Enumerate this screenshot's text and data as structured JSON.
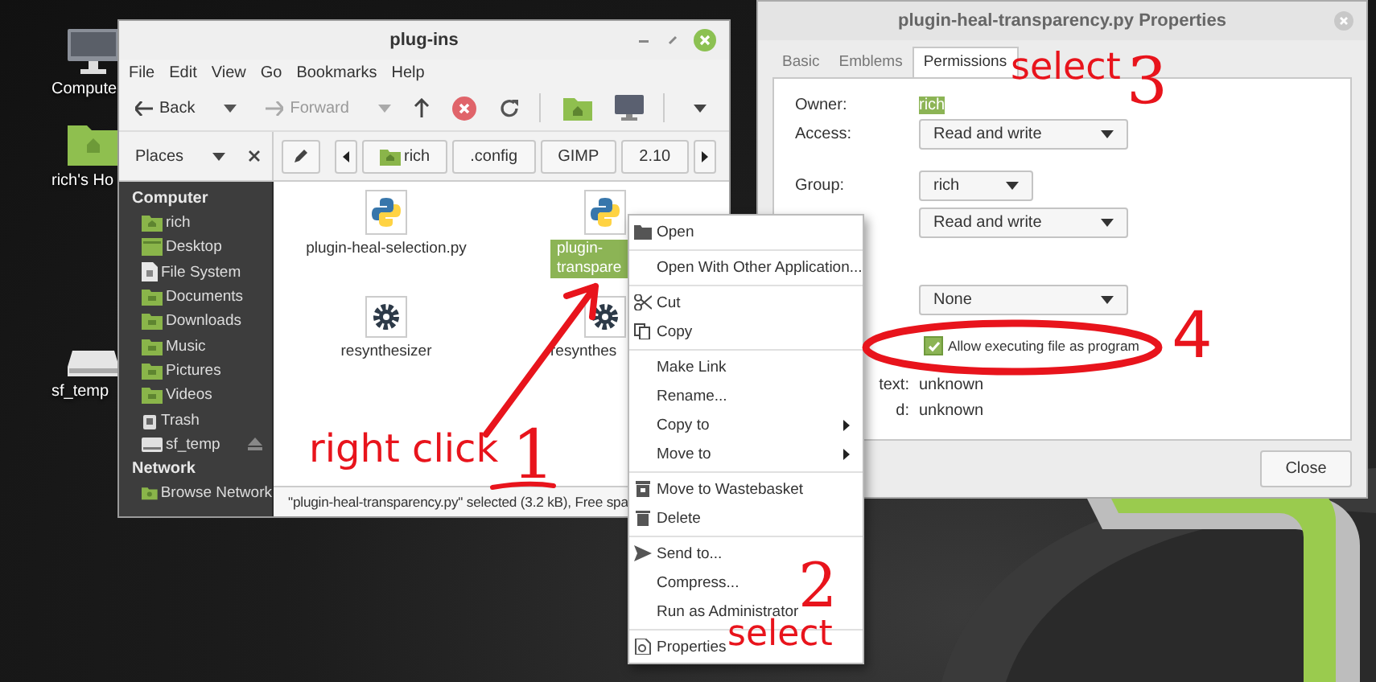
{
  "desktop": {
    "icons": [
      {
        "label": "Compute",
        "kind": "computer"
      },
      {
        "label": "rich's Ho",
        "kind": "home"
      },
      {
        "label": "sf_temp",
        "kind": "drive"
      }
    ]
  },
  "file_manager": {
    "title": "plug-ins",
    "menu": [
      "File",
      "Edit",
      "View",
      "Go",
      "Bookmarks",
      "Help"
    ],
    "toolbar": {
      "back": "Back",
      "forward": "Forward"
    },
    "places": "Places",
    "path": [
      {
        "label": "rich",
        "kind": "home"
      },
      {
        "label": ".config",
        "kind": "plain"
      },
      {
        "label": "GIMP",
        "kind": "plain"
      },
      {
        "label": "2.10",
        "kind": "plain"
      }
    ],
    "sidebar": [
      {
        "heading": "Computer",
        "items": [
          {
            "label": "rich",
            "kind": "home",
            "ejectable": false
          },
          {
            "label": "Desktop",
            "kind": "desktop",
            "ejectable": false
          },
          {
            "label": "File System",
            "kind": "filesystem",
            "ejectable": false
          },
          {
            "label": "Documents",
            "kind": "folder",
            "ejectable": false
          },
          {
            "label": "Downloads",
            "kind": "folder",
            "ejectable": false
          },
          {
            "label": "Music",
            "kind": "folder",
            "ejectable": false
          },
          {
            "label": "Pictures",
            "kind": "folder",
            "ejectable": false
          },
          {
            "label": "Videos",
            "kind": "folder",
            "ejectable": false
          },
          {
            "label": "Trash",
            "kind": "trash",
            "ejectable": false
          },
          {
            "label": "sf_temp",
            "kind": "drive",
            "ejectable": true
          }
        ]
      },
      {
        "heading": "Network",
        "items": [
          {
            "label": "Browse Network",
            "kind": "network",
            "ejectable": false
          }
        ]
      }
    ],
    "files": [
      {
        "lines": [
          "plugin-heal-selection.py"
        ],
        "kind": "python",
        "selected": false
      },
      {
        "lines": [
          "plugin-",
          "transpare"
        ],
        "kind": "python",
        "selected": true
      },
      {
        "lines": [
          "resynthesizer"
        ],
        "kind": "executable",
        "selected": false
      },
      {
        "lines": [
          "resynthes"
        ],
        "kind": "executable",
        "selected": false
      }
    ],
    "status": "\"plugin-heal-transparency.py\" selected (3.2 kB), Free spa"
  },
  "properties": {
    "title": "plugin-heal-transparency.py Properties",
    "tabs": [
      {
        "label": "Basic",
        "selected": false
      },
      {
        "label": "Emblems",
        "selected": false
      },
      {
        "label": "Permissions",
        "selected": true
      }
    ],
    "sections": [
      [
        {
          "kind": "text",
          "label": "Owner:",
          "value": "rich",
          "selected": true
        },
        {
          "kind": "dropdown",
          "label": "Access:",
          "value": "Read and write"
        }
      ],
      [
        {
          "kind": "short-dropdown",
          "label": "Group:",
          "value": "rich"
        },
        {
          "kind": "dropdown",
          "value": "Read and write"
        }
      ],
      [
        {
          "kind": "dropdown",
          "value": "None"
        },
        {
          "kind": "checkbox",
          "label": "Allow executing file as program",
          "checked": true
        },
        {
          "kind": "info",
          "label": "text:",
          "value": "unknown"
        },
        {
          "kind": "info",
          "label": "d:",
          "value": "unknown"
        }
      ]
    ],
    "close": "Close"
  },
  "context_menu": [
    {
      "kind": "folder",
      "label": "Open",
      "submenu": false
    },
    {
      "kind": "separator"
    },
    {
      "kind": "plain",
      "label": "Open With Other Application...",
      "submenu": false
    },
    {
      "kind": "separator"
    },
    {
      "kind": "cut",
      "label": "Cut",
      "submenu": false
    },
    {
      "kind": "copy",
      "label": "Copy",
      "submenu": false
    },
    {
      "kind": "separator"
    },
    {
      "kind": "plain",
      "label": "Make Link",
      "submenu": false
    },
    {
      "kind": "plain",
      "label": "Rename...",
      "submenu": false
    },
    {
      "kind": "plain",
      "label": "Copy to",
      "submenu": true
    },
    {
      "kind": "plain",
      "label": "Move to",
      "submenu": true
    },
    {
      "kind": "separator"
    },
    {
      "kind": "wastebasket",
      "label": "Move to Wastebasket",
      "submenu": false
    },
    {
      "kind": "delete",
      "label": "Delete",
      "submenu": false
    },
    {
      "kind": "separator"
    },
    {
      "kind": "send",
      "label": "Send to...",
      "submenu": false
    },
    {
      "kind": "plain",
      "label": "Compress...",
      "submenu": false
    },
    {
      "kind": "plain",
      "label": "Run as Administrator",
      "submenu": false
    },
    {
      "kind": "separator"
    },
    {
      "kind": "properties",
      "label": "Properties",
      "submenu": false
    }
  ],
  "annotations": [
    {
      "text": "right click"
    },
    {
      "text": "1"
    },
    {
      "text": "2"
    },
    {
      "text": "select"
    },
    {
      "text": "select"
    },
    {
      "text": "3"
    },
    {
      "text": "4"
    }
  ]
}
